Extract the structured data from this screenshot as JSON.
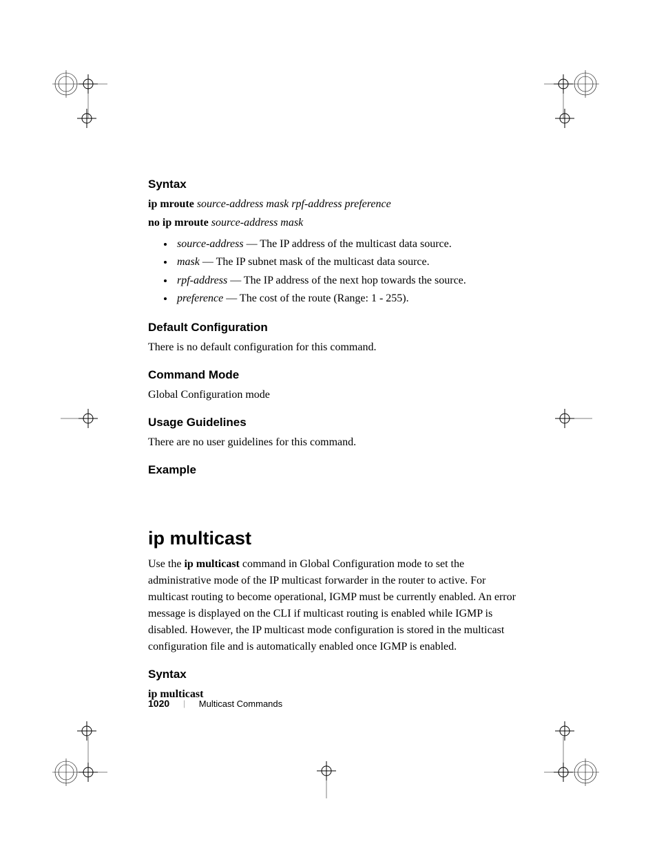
{
  "syntax1": {
    "heading": "Syntax",
    "line1_bold": "ip mroute ",
    "line1_italic": "source-address mask rpf-address preference",
    "line2_bold": "no ip mroute ",
    "line2_italic": "source-address mask",
    "bullets": [
      {
        "term": "source-address",
        "desc": " — The IP address of the multicast data source."
      },
      {
        "term": "mask",
        "desc": " — The IP subnet mask of the multicast data source."
      },
      {
        "term": "rpf-address",
        "desc": " — The IP address of the next hop towards the source."
      },
      {
        "term": "preference",
        "desc": " — The cost of the route (Range:  1 - 255)."
      }
    ]
  },
  "default_config": {
    "heading": "Default Configuration",
    "text": "There is no default configuration for this command."
  },
  "command_mode": {
    "heading": "Command Mode",
    "text": "Global Configuration mode"
  },
  "usage": {
    "heading": "Usage Guidelines",
    "text": "There are no user guidelines for this command."
  },
  "example": {
    "heading": "Example"
  },
  "ip_multicast": {
    "heading": "ip multicast",
    "para_pre": "Use the ",
    "para_bold": "ip multicast",
    "para_post": " command in Global Configuration mode to set the administrative mode of the IP multicast forwarder in the router to active. For multicast routing to become operational, IGMP must be currently enabled. An error message is displayed on the CLI if multicast routing is enabled while IGMP is disabled. However, the IP multicast mode configuration is stored in the multicast configuration file and is automatically enabled once IGMP is enabled."
  },
  "syntax2": {
    "heading": "Syntax",
    "line_bold": "ip multicast"
  },
  "footer": {
    "page": "1020",
    "sep": "|",
    "title": "Multicast Commands"
  }
}
